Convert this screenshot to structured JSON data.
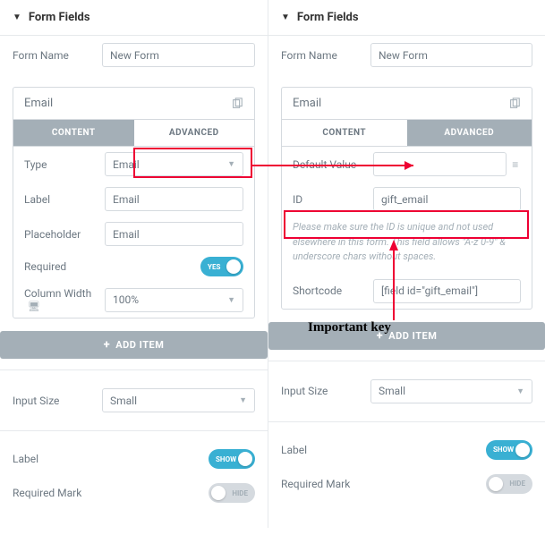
{
  "left": {
    "header": "Form Fields",
    "form_name_label": "Form Name",
    "form_name_value": "New Form",
    "field_title": "Email",
    "tab_content": "CONTENT",
    "tab_advanced": "ADVANCED",
    "type_label": "Type",
    "type_value": "Email",
    "label_label": "Label",
    "label_value": "Email",
    "placeholder_label": "Placeholder",
    "placeholder_value": "Email",
    "required_label": "Required",
    "required_toggle": "YES",
    "colwidth_label": "Column Width",
    "colwidth_value": "100%",
    "add_item": "ADD ITEM",
    "input_size_label": "Input Size",
    "input_size_value": "Small",
    "label_toggle_label": "Label",
    "label_toggle_text": "SHOW",
    "reqmark_label": "Required Mark",
    "reqmark_toggle_text": "HIDE"
  },
  "right": {
    "header": "Form Fields",
    "form_name_label": "Form Name",
    "form_name_value": "New Form",
    "field_title": "Email",
    "tab_content": "CONTENT",
    "tab_advanced": "ADVANCED",
    "default_label": "Default Value",
    "default_value": "",
    "id_label": "ID",
    "id_value": "gift_email",
    "id_help": "Please make sure the ID is unique and not used elsewhere in this form. This field allows \"A-z 0-9\" & underscore chars without spaces.",
    "shortcode_label": "Shortcode",
    "shortcode_value": "[field id=\"gift_email\"]",
    "add_item": "ADD ITEM",
    "input_size_label": "Input Size",
    "input_size_value": "Small",
    "label_toggle_label": "Label",
    "label_toggle_text": "SHOW",
    "reqmark_label": "Required Mark",
    "reqmark_toggle_text": "HIDE"
  },
  "annotation": "Important key"
}
